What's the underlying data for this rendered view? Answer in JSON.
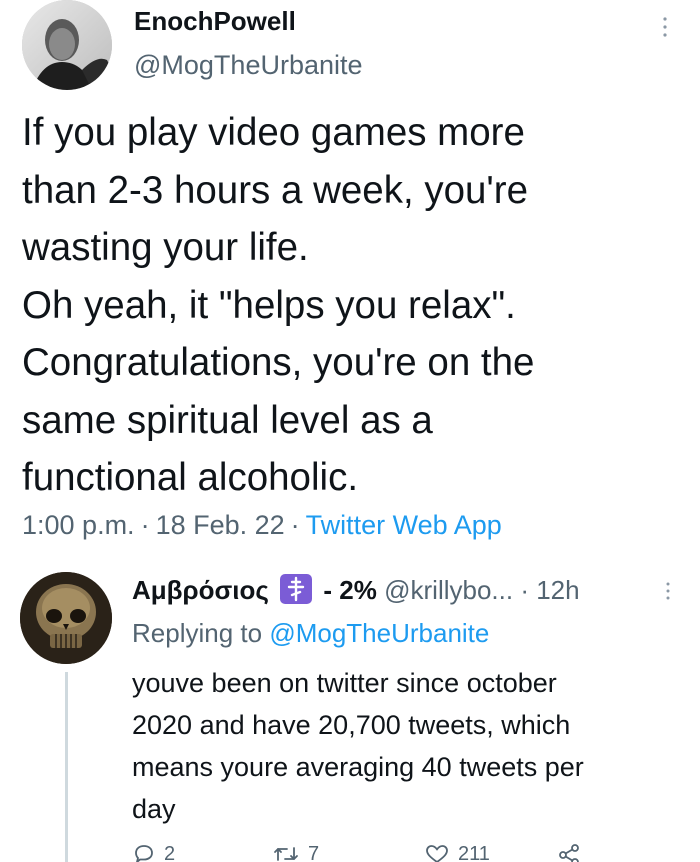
{
  "main_tweet": {
    "author": {
      "display_name": "EnochPowell",
      "handle": "@MogTheUrbanite"
    },
    "text_lines": [
      "If you play video games more",
      "than 2-3 hours a week, you're",
      "wasting your life.",
      "Oh yeah, it \"helps you relax\".",
      "Congratulations, you're on the",
      "same spiritual level as a",
      "functional alcoholic."
    ],
    "meta": {
      "time": "1:00 p.m.",
      "date": "18 Feb. 22",
      "source": "Twitter Web App",
      "separator": "·"
    }
  },
  "reply": {
    "author": {
      "display_name": "Αμβρόσιος",
      "flair": "- 2%",
      "handle": "@krillybo...",
      "time": "· 12h",
      "badge_color": "#7b5cd6"
    },
    "replying_to_label": "Replying to",
    "replying_to_handle": "@MogTheUrbanite",
    "text_lines": [
      "youve been on twitter since october",
      "2020 and have 20,700 tweets, which",
      "means youre averaging 40 tweets per",
      "day"
    ],
    "actions": {
      "replies": "2",
      "retweets": "7",
      "likes": "211"
    }
  },
  "colors": {
    "text": "#0f1419",
    "secondary": "#536471",
    "link": "#1d9bf0"
  }
}
